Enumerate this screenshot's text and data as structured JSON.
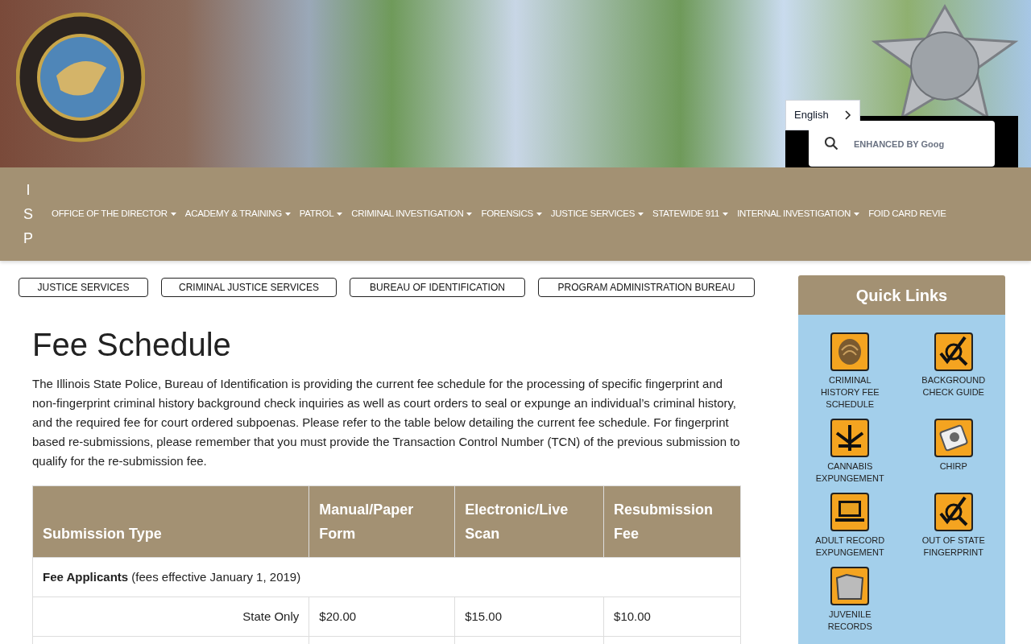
{
  "header": {
    "language": {
      "label": "English"
    },
    "search": {
      "placeholder": "ENHANCED BY Goog"
    }
  },
  "nav": {
    "brand": "ISP",
    "items": [
      {
        "label": "OFFICE OF THE DIRECTOR",
        "dropdown": true
      },
      {
        "label": "ACADEMY & TRAINING",
        "dropdown": true
      },
      {
        "label": "PATROL",
        "dropdown": true
      },
      {
        "label": "CRIMINAL INVESTIGATION",
        "dropdown": true
      },
      {
        "label": "FORENSICS",
        "dropdown": true
      },
      {
        "label": "JUSTICE SERVICES",
        "dropdown": true
      },
      {
        "label": "STATEWIDE 911",
        "dropdown": true
      },
      {
        "label": "INTERNAL INVESTIGATION",
        "dropdown": true
      },
      {
        "label": "FOID CARD REVIE",
        "dropdown": false
      }
    ]
  },
  "breadcrumbs": [
    "JUSTICE SERVICES",
    "CRIMINAL JUSTICE SERVICES",
    "BUREAU OF IDENTIFICATION",
    "PROGRAM ADMINISTRATION BUREAU"
  ],
  "page": {
    "title": "Fee Schedule",
    "intro": "The Illinois State Police, Bureau of Identification is providing the current fee schedule for the processing of specific fingerprint and non-fingerprint criminal history background check inquiries as well as court orders to seal or expunge an individual’s criminal history, and the required fee for court ordered subpoenas. Please refer to the table below detailing the current fee schedule. For fingerprint based re-submissions, please remember that you must provide the Transaction Control Number (TCN) of the previous submission to qualify for the re-submission fee."
  },
  "table": {
    "columns": [
      "Submission Type",
      "Manual/Paper Form",
      "Electronic/Live Scan",
      "Resubmission Fee"
    ],
    "rows": [
      {
        "kind": "section",
        "text": "**Fee Applicants** (fees effective January 1, 2019)"
      },
      {
        "kind": "fee",
        "cells": [
          "State Only",
          "$20.00",
          "$15.00",
          "$10.00"
        ]
      },
      {
        "kind": "fee",
        "cells": [
          "",
          "",
          "",
          ""
        ]
      }
    ]
  },
  "quick_links": {
    "title": "Quick Links",
    "items": [
      {
        "label": "CRIMINAL HISTORY FEE SCHEDULE",
        "kind": "fingerprint"
      },
      {
        "label": "BACKGROUND CHECK GUIDE",
        "kind": "check"
      },
      {
        "label": "CANNABIS EXPUNGEMENT",
        "kind": "leaf"
      },
      {
        "label": "CHIRP",
        "kind": "card"
      },
      {
        "label": "ADULT RECORD EXPUNGEMENT",
        "kind": "laptop"
      },
      {
        "label": "OUT OF STATE FINGERPRINT",
        "kind": "check"
      },
      {
        "label": "JUVENILE RECORDS",
        "kind": "folder"
      }
    ]
  }
}
